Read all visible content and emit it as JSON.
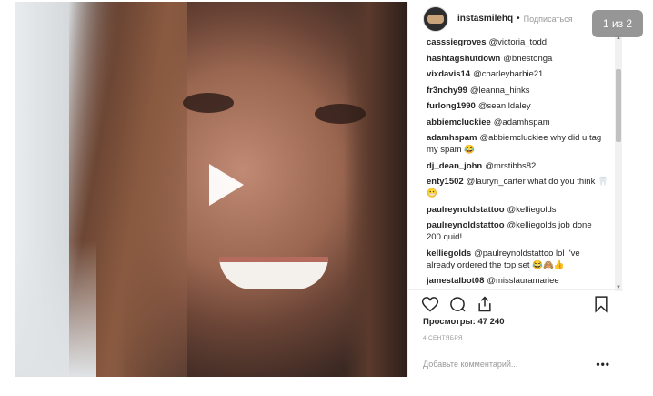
{
  "post": {
    "username": "instasmilehq",
    "separator": "•",
    "follow_label": "Подписаться",
    "counter": "1 из 2"
  },
  "comments": [
    {
      "user": "casssiegroves",
      "text": "@victoria_todd"
    },
    {
      "user": "hashtagshutdown",
      "text": "@bnestonga"
    },
    {
      "user": "vixdavis14",
      "text": "@charleybarbie21"
    },
    {
      "user": "fr3nchy99",
      "text": "@leanna_hinks"
    },
    {
      "user": "furlong1990",
      "text": "@sean.ldaley"
    },
    {
      "user": "abbiemcluckiee",
      "text": "@adamhspam"
    },
    {
      "user": "adamhspam",
      "text": "@abbiemcluckiee why did u tag my spam 😂"
    },
    {
      "user": "dj_dean_john",
      "text": "@mrstibbs82"
    },
    {
      "user": "enty1502",
      "text": "@lauryn_carter what do you think 🦷😬"
    },
    {
      "user": "paulreynoldstattoo",
      "text": "@kelliegolds"
    },
    {
      "user": "paulreynoldstattoo",
      "text": "@kelliegolds job done 200 quid!"
    },
    {
      "user": "kelliegolds",
      "text": "@paulreynoldstattoo lol I've already ordered the top set 😂🙈👍"
    },
    {
      "user": "jamestalbot08",
      "text": "@misslauramariee"
    }
  ],
  "icons": {
    "like": "heart-icon",
    "comment": "comment-icon",
    "share": "share-icon",
    "save": "bookmark-icon",
    "play": "play-icon",
    "more": "more-options-icon"
  },
  "stats": {
    "views_label": "Просмотры:",
    "views_value": "47 240",
    "date": "4 СЕНТЯБРЯ"
  },
  "compose": {
    "placeholder": "Добавьте комментарий...",
    "more_label": "•••"
  },
  "colors": {
    "text": "#262626",
    "muted": "#999999",
    "border": "#efefef"
  }
}
